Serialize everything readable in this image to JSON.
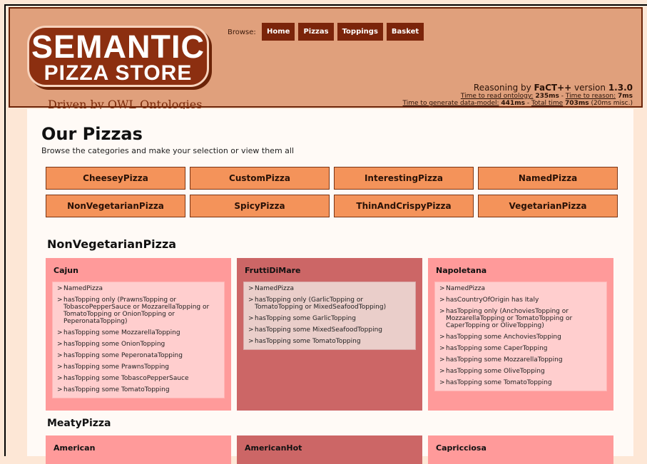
{
  "header": {
    "logo_line1": "SEMANTIC",
    "logo_line2": "PIZZA STORE",
    "tagline": "Driven by OWL Ontologies",
    "browse_label": "Browse:",
    "nav": [
      "Home",
      "Pizzas",
      "Toppings",
      "Basket"
    ],
    "stats": {
      "reasoning_prefix": "Reasoning by ",
      "reasoner": "FaCT++",
      "version_prefix": " version ",
      "version": "1.3.0",
      "read_label": "Time to read ontology:",
      "read_value": "235ms",
      "reason_label": "Time to reason:",
      "reason_value": "7ms",
      "datamodel_label": "Time to generate data-model:",
      "datamodel_value": "441ms",
      "total_label": "Total time",
      "total_value": "703ms",
      "misc": "(20ms misc.)",
      "sep": " - "
    }
  },
  "page": {
    "title": "Our Pizzas",
    "subtitle": "Browse the categories and make your selection or view them all"
  },
  "categories": [
    "CheeseyPizza",
    "CustomPizza",
    "InterestingPizza",
    "NamedPizza",
    "NonVegetarianPizza",
    "SpicyPizza",
    "ThinAndCrispyPizza",
    "VegetarianPizza"
  ],
  "sections": [
    {
      "title": "NonVegetarianPizza",
      "pizzas": [
        {
          "name": "Cajun",
          "props": [
            "NamedPizza",
            "hasTopping only (PrawnsTopping or TobascoPepperSauce or MozzarellaTopping or TomatoTopping or OnionTopping or PeperonataTopping)",
            "hasTopping some MozzarellaTopping",
            "hasTopping some OnionTopping",
            "hasTopping some PeperonataTopping",
            "hasTopping some PrawnsTopping",
            "hasTopping some TobascoPepperSauce",
            "hasTopping some TomatoTopping"
          ]
        },
        {
          "name": "FruttiDiMare",
          "props": [
            "NamedPizza",
            "hasTopping only (GarlicTopping or TomatoTopping or MixedSeafoodTopping)",
            "hasTopping some GarlicTopping",
            "hasTopping some MixedSeafoodTopping",
            "hasTopping some TomatoTopping"
          ]
        },
        {
          "name": "Napoletana",
          "props": [
            "NamedPizza",
            "hasCountryOfOrigin has Italy",
            "hasTopping only (AnchoviesTopping or MozzarellaTopping or TomatoTopping or CaperTopping or OliveTopping)",
            "hasTopping some AnchoviesTopping",
            "hasTopping some CaperTopping",
            "hasTopping some MozzarellaTopping",
            "hasTopping some OliveTopping",
            "hasTopping some TomatoTopping"
          ]
        }
      ]
    },
    {
      "title": "MeatyPizza",
      "pizzas": [
        {
          "name": "American"
        },
        {
          "name": "AmericanHot"
        },
        {
          "name": "Capricciosa"
        }
      ]
    }
  ]
}
